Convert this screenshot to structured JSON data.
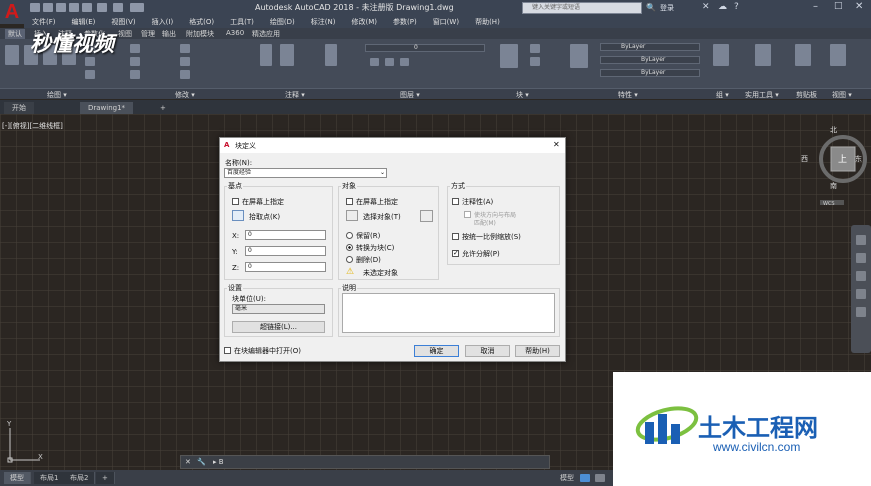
{
  "app": {
    "title": "Autodesk AutoCAD 2018 - 未注册版    Drawing1.dwg",
    "search_placeholder": "键入关键字或短语",
    "login": "登录",
    "app_letter": "A"
  },
  "menu": [
    "文件(F)",
    "编辑(E)",
    "视图(V)",
    "插入(I)",
    "格式(O)",
    "工具(T)",
    "绘图(D)",
    "标注(N)",
    "修改(M)",
    "参数(P)",
    "窗口(W)",
    "帮助(H)"
  ],
  "ribbon_tabs": [
    "默认",
    "插入",
    "注释",
    "参数化",
    "视图",
    "管理",
    "输出",
    "附加模块",
    "A360",
    "精选应用"
  ],
  "ribbon_panels": [
    "绘图 ▾",
    "修改 ▾",
    "注释 ▾",
    "图层 ▾",
    "块 ▾",
    "特性 ▾",
    "组 ▾",
    "实用工具 ▾",
    "剪贴板",
    "视图 ▾"
  ],
  "ribbon_props": {
    "bylayer1": "ByLayer",
    "bylayer2": "ByLayer",
    "bylayer3": "ByLayer",
    "layer_value": "0"
  },
  "watermark": "秒懂视频",
  "doc_tabs": {
    "start": "开始",
    "drawing": "Drawing1*",
    "add": "+"
  },
  "viewport_label": "[-][俯视][二维线框]",
  "viewcube": {
    "north": "北",
    "south": "南",
    "east": "东",
    "west": "西",
    "top": "上",
    "wcs": "WCS"
  },
  "ucs": {
    "x": "X",
    "y": "Y"
  },
  "command_line": {
    "text": "▸ B"
  },
  "layout_tabs": [
    "模型",
    "布局1",
    "布局2",
    "+"
  ],
  "status": {
    "model": "模型"
  },
  "logo": {
    "name": "土木工程网",
    "url": "www.civilcn.com"
  },
  "dialog": {
    "title": "块定义",
    "close": "✕",
    "name_label": "名称(N):",
    "name_value": "百度经验",
    "base_point": {
      "group": "基点",
      "specify_on_screen": "在屏幕上指定",
      "pick_point": "拾取点(K)",
      "x_label": "X:",
      "x_value": "0",
      "y_label": "Y:",
      "y_value": "0",
      "z_label": "Z:",
      "z_value": "0"
    },
    "objects": {
      "group": "对象",
      "specify_on_screen": "在屏幕上指定",
      "select_objects": "选择对象(T)",
      "retain": "保留(R)",
      "convert": "转换为块(C)",
      "delete": "删除(D)",
      "none_selected": "未选定对象"
    },
    "behavior": {
      "group": "方式",
      "annotative": "注释性(A)",
      "match_orientation": "使块方向与布局",
      "match_orientation2": "匹配(M)",
      "scale_uniformly": "按统一比例缩放(S)",
      "allow_exploding": "允许分解(P)"
    },
    "settings": {
      "group": "设置",
      "block_unit_label": "块单位(U):",
      "block_unit_value": "毫米",
      "hyperlink": "超链接(L)..."
    },
    "description": {
      "group": "说明"
    },
    "open_in_editor": "在块编辑器中打开(O)",
    "ok": "确定",
    "cancel": "取消",
    "help": "帮助(H)"
  }
}
